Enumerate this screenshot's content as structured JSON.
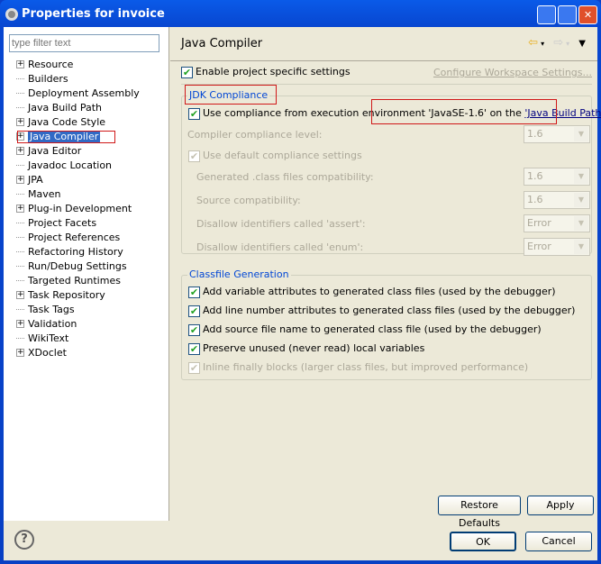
{
  "window": {
    "title": "Properties for invoice"
  },
  "filter": {
    "placeholder": "type filter text"
  },
  "tree": [
    {
      "label": "Resource",
      "expandable": true
    },
    {
      "label": "Builders",
      "expandable": false
    },
    {
      "label": "Deployment Assembly",
      "expandable": false
    },
    {
      "label": "Java Build Path",
      "expandable": false
    },
    {
      "label": "Java Code Style",
      "expandable": true
    },
    {
      "label": "Java Compiler",
      "expandable": true,
      "selected": true
    },
    {
      "label": "Java Editor",
      "expandable": true
    },
    {
      "label": "Javadoc Location",
      "expandable": false
    },
    {
      "label": "JPA",
      "expandable": true
    },
    {
      "label": "Maven",
      "expandable": false
    },
    {
      "label": "Plug-in Development",
      "expandable": true
    },
    {
      "label": "Project Facets",
      "expandable": false
    },
    {
      "label": "Project References",
      "expandable": false
    },
    {
      "label": "Refactoring History",
      "expandable": false
    },
    {
      "label": "Run/Debug Settings",
      "expandable": false
    },
    {
      "label": "Targeted Runtimes",
      "expandable": false
    },
    {
      "label": "Task Repository",
      "expandable": true
    },
    {
      "label": "Task Tags",
      "expandable": false
    },
    {
      "label": "Validation",
      "expandable": true
    },
    {
      "label": "WikiText",
      "expandable": false
    },
    {
      "label": "XDoclet",
      "expandable": true
    }
  ],
  "page": {
    "title": "Java Compiler",
    "enable_label": "Enable project specific settings",
    "configure_link": "Configure Workspace Settings...",
    "jdk": {
      "label": "JDK Compliance",
      "use_env_prefix": "Use compliance from execution environment 'JavaSE-1.6' on the ",
      "use_env_link": "'Java Build Path'",
      "compliance_label": "Compiler compliance level:",
      "compliance_value": "1.6",
      "default_label": "Use default compliance settings",
      "generated_label": "Generated .class files compatibility:",
      "generated_value": "1.6",
      "source_label": "Source compatibility:",
      "source_value": "1.6",
      "assert_label": "Disallow identifiers called 'assert':",
      "assert_value": "Error",
      "enum_label": "Disallow identifiers called 'enum':",
      "enum_value": "Error"
    },
    "classfile": {
      "label": "Classfile Generation",
      "items": [
        {
          "label": "Add variable attributes to generated class files (used by the debugger)",
          "checked": true
        },
        {
          "label": "Add line number attributes to generated class files (used by the debugger)",
          "checked": true
        },
        {
          "label": "Add source file name to generated class file (used by the debugger)",
          "checked": true
        },
        {
          "label": "Preserve unused (never read) local variables",
          "checked": true
        },
        {
          "label": "Inline finally blocks (larger class files, but improved performance)",
          "checked": true,
          "disabled": true
        }
      ]
    },
    "restore_label": "Restore Defaults",
    "apply_label": "Apply"
  },
  "footer": {
    "ok_label": "OK",
    "cancel_label": "Cancel"
  }
}
